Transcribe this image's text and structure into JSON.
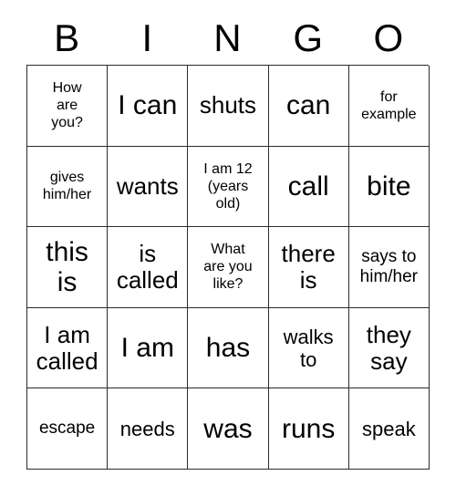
{
  "card": {
    "header_letters": [
      "B",
      "I",
      "N",
      "G",
      "O"
    ],
    "rows": [
      [
        {
          "text": "How\nare\nyou?",
          "size": "xs"
        },
        {
          "text": "I can",
          "size": "xl"
        },
        {
          "text": "shuts",
          "size": "lg"
        },
        {
          "text": "can",
          "size": "xl"
        },
        {
          "text": "for\nexample",
          "size": "xs"
        }
      ],
      [
        {
          "text": "gives\nhim/her",
          "size": "xs"
        },
        {
          "text": "wants",
          "size": "lg"
        },
        {
          "text": "I am 12\n(years\nold)",
          "size": "xs"
        },
        {
          "text": "call",
          "size": "xl"
        },
        {
          "text": "bite",
          "size": "xl"
        }
      ],
      [
        {
          "text": "this\nis",
          "size": "xl"
        },
        {
          "text": "is\ncalled",
          "size": "lg"
        },
        {
          "text": "What\nare you\nlike?",
          "size": "xs"
        },
        {
          "text": "there\nis",
          "size": "lg"
        },
        {
          "text": "says to\nhim/her",
          "size": "sm"
        }
      ],
      [
        {
          "text": "I am\ncalled",
          "size": "lg"
        },
        {
          "text": "I am",
          "size": "xl"
        },
        {
          "text": "has",
          "size": "xl"
        },
        {
          "text": "walks\nto",
          "size": "md"
        },
        {
          "text": "they\nsay",
          "size": "lg"
        }
      ],
      [
        {
          "text": "escape",
          "size": "sm"
        },
        {
          "text": "needs",
          "size": "md"
        },
        {
          "text": "was",
          "size": "xl"
        },
        {
          "text": "runs",
          "size": "xl"
        },
        {
          "text": "speak",
          "size": "md"
        }
      ]
    ]
  },
  "style": {
    "border_color": "#2b2b2b",
    "text_color": "#000000",
    "background": "#ffffff"
  }
}
